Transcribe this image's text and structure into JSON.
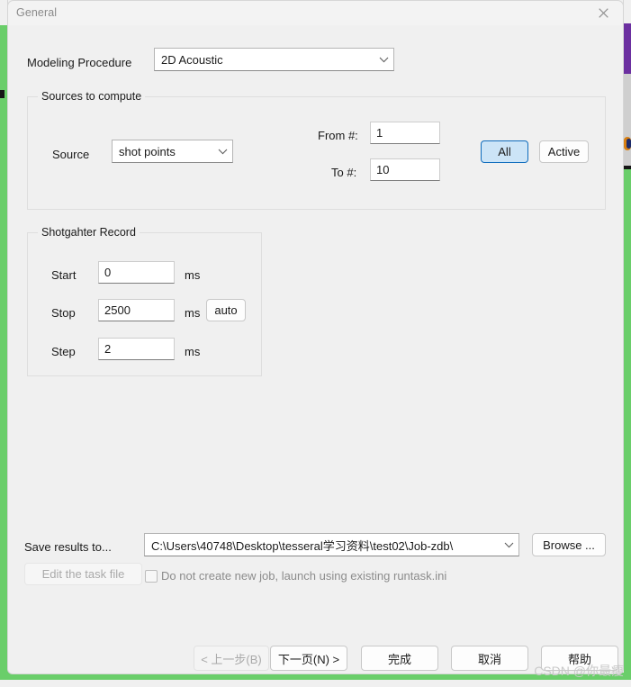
{
  "window": {
    "title": "General",
    "close_icon": "close-icon"
  },
  "modeling": {
    "label": "Modeling Procedure",
    "value": "2D Acoustic"
  },
  "sources_group": {
    "title": "Sources to compute",
    "source_label": "Source",
    "source_value": "shot points",
    "from_label": "From #:",
    "from_value": "1",
    "to_label": "To #:",
    "to_value": "10",
    "all_button": "All",
    "active_button": "Active"
  },
  "record_group": {
    "title": "Shotgahter Record",
    "start_label": "Start",
    "start_value": "0",
    "start_unit": "ms",
    "stop_label": "Stop",
    "stop_value": "2500",
    "stop_unit": "ms",
    "auto_button": "auto",
    "step_label": "Step",
    "step_value": "2",
    "step_unit": "ms"
  },
  "save": {
    "label": "Save results to...",
    "path_value": "C:\\Users\\40748\\Desktop\\tesseral学习资料\\test02\\Job-zdb\\",
    "browse_button": "Browse ...",
    "edit_task_button": "Edit the task file",
    "checkbox_label": "Do not create new job, launch using existing runtask.ini",
    "checkbox_checked": false
  },
  "footer": {
    "back_button": "< 上一步(B)",
    "next_button": "下一页(N) >",
    "finish_button": "完成",
    "cancel_button": "取消",
    "help_button": "帮助"
  },
  "watermark": "CSDN @你最瘦",
  "colors": {
    "accent_blue": "#0f6cbd",
    "accent_blue_fill": "#cce4f7",
    "backdrop_green": "#6ace6a",
    "backdrop_purple": "#6b2fa0",
    "dialog_bg": "#f0f0f0"
  }
}
